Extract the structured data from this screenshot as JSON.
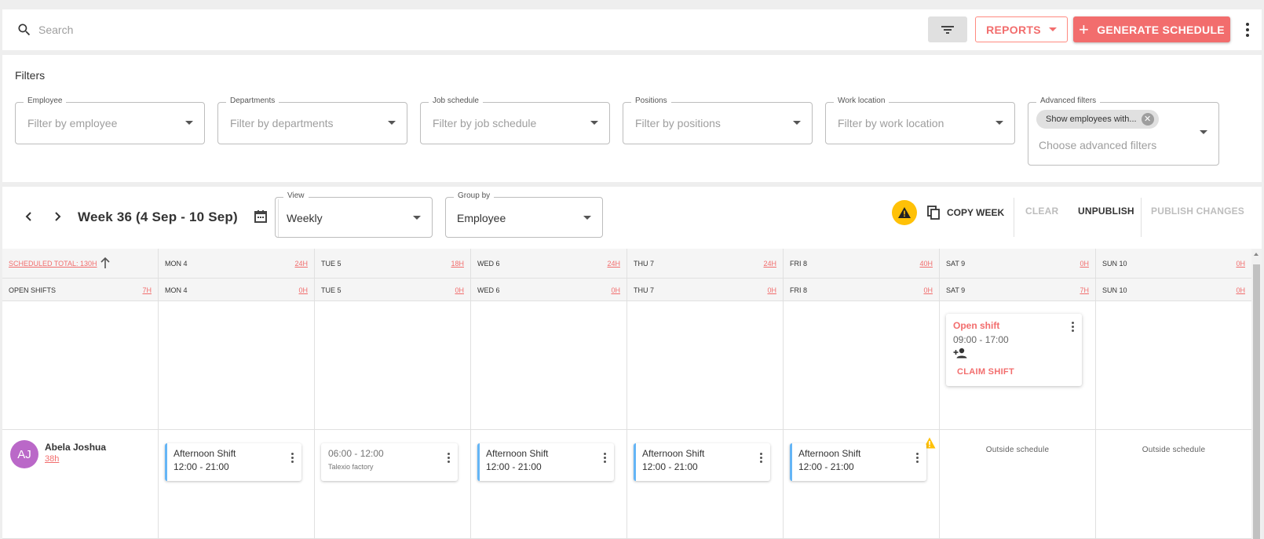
{
  "search": {
    "placeholder": "Search"
  },
  "toolbar": {
    "reports_label": "REPORTS",
    "generate_label": "GENERATE SCHEDULE"
  },
  "filters": {
    "title": "Filters",
    "employee": {
      "label": "Employee",
      "placeholder": "Filter by employee"
    },
    "departments": {
      "label": "Departments",
      "placeholder": "Filter by departments"
    },
    "job_schedule": {
      "label": "Job schedule",
      "placeholder": "Filter by job schedule"
    },
    "positions": {
      "label": "Positions",
      "placeholder": "Filter by positions"
    },
    "work_location": {
      "label": "Work location",
      "placeholder": "Filter by work location"
    },
    "advanced": {
      "label": "Advanced filters",
      "chip": "Show employees with...",
      "placeholder": "Choose advanced filters"
    }
  },
  "schedule": {
    "week_title": "Week 36 (4 Sep - 10 Sep)",
    "view": {
      "label": "View",
      "value": "Weekly"
    },
    "group_by": {
      "label": "Group by",
      "value": "Employee"
    },
    "actions": {
      "copy_week": "COPY WEEK",
      "clear": "CLEAR",
      "unpublish": "UNPUBLISH",
      "publish": "PUBLISH CHANGES"
    }
  },
  "grid": {
    "total_label": "SCHEDULED TOTAL: 130H",
    "open_shifts_label": "OPEN SHIFTS",
    "open_shifts_hours": "7H",
    "days": [
      {
        "label": "MON 4",
        "hours": "24H",
        "open_hours": "0H"
      },
      {
        "label": "TUE 5",
        "hours": "18H",
        "open_hours": "0H"
      },
      {
        "label": "WED 6",
        "hours": "24H",
        "open_hours": "0H"
      },
      {
        "label": "THU 7",
        "hours": "24H",
        "open_hours": "0H"
      },
      {
        "label": "FRI 8",
        "hours": "40H",
        "open_hours": "0H"
      },
      {
        "label": "SAT 9",
        "hours": "0H",
        "open_hours": "7H"
      },
      {
        "label": "SUN 10",
        "hours": "0H",
        "open_hours": "0H"
      }
    ],
    "open_shift_card": {
      "title": "Open shift",
      "time": "09:00 - 17:00",
      "claim": "CLAIM SHIFT"
    },
    "employee": {
      "initials": "AJ",
      "name": "Abela Joshua",
      "hours": "38h",
      "avatar_color": "#ba68c8"
    },
    "shifts": [
      {
        "title": "Afternoon Shift",
        "time": "12:00 - 21:00"
      },
      {
        "title": "06:00 - 12:00",
        "time": "Talexio factory"
      },
      {
        "title": "Afternoon Shift",
        "time": "12:00 - 21:00"
      },
      {
        "title": "Afternoon Shift",
        "time": "12:00 - 21:00"
      },
      {
        "title": "Afternoon Shift",
        "time": "12:00 - 21:00"
      }
    ],
    "outside_label": "Outside schedule"
  },
  "colors": {
    "accent": "#f26d6d",
    "shift_border": "#64b5f6",
    "warning": "#ffc107"
  }
}
